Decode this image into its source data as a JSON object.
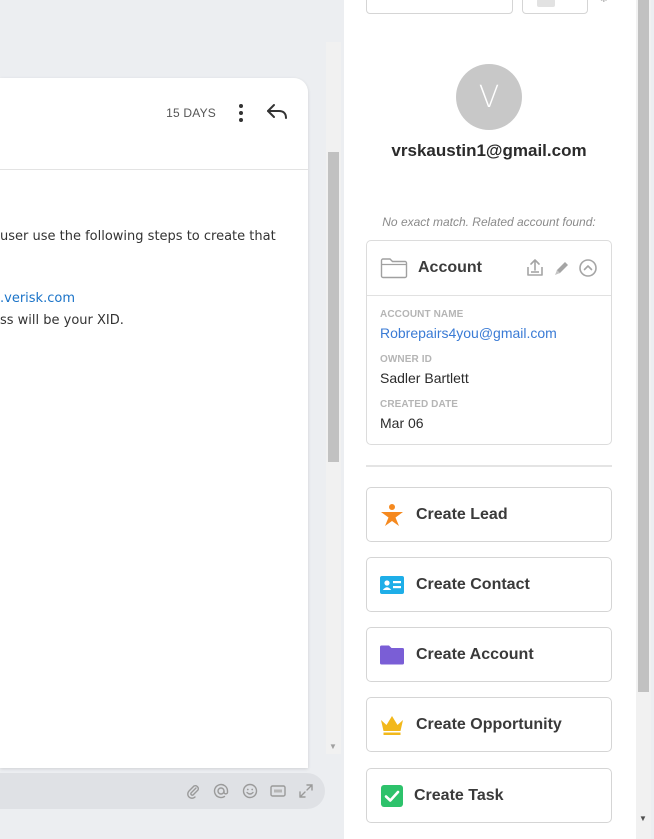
{
  "email": {
    "age_label": "15 DAYS",
    "body_lines": [
      "user use the following steps to create that",
      ".verisk.com",
      "ss will be your XID."
    ]
  },
  "crm_panel": {
    "avatar_initial": "V",
    "contact_email": "vrskaustin1@gmail.com",
    "match_note": "No exact match. Related account found:",
    "account_card": {
      "title": "Account",
      "fields": [
        {
          "label": "ACCOUNT NAME",
          "value": "Robrepairs4you@gmail.com"
        },
        {
          "label": "OWNER ID",
          "value": "Sadler Bartlett"
        },
        {
          "label": "CREATED DATE",
          "value": "Mar 06"
        }
      ]
    },
    "create_buttons": [
      {
        "label": "Create Lead",
        "icon": "star-person-icon",
        "color": "#f5891f"
      },
      {
        "label": "Create Contact",
        "icon": "contact-card-icon",
        "color": "#1eaee8"
      },
      {
        "label": "Create Account",
        "icon": "folder-icon",
        "color": "#7a5ed6"
      },
      {
        "label": "Create Opportunity",
        "icon": "crown-icon",
        "color": "#f2b81b"
      },
      {
        "label": "Create Task",
        "icon": "checkbox-icon",
        "color": "#2dc26b"
      }
    ]
  },
  "composer_icons": [
    "attach-icon",
    "mention-icon",
    "emoji-icon",
    "gif-icon",
    "expand-icon"
  ]
}
